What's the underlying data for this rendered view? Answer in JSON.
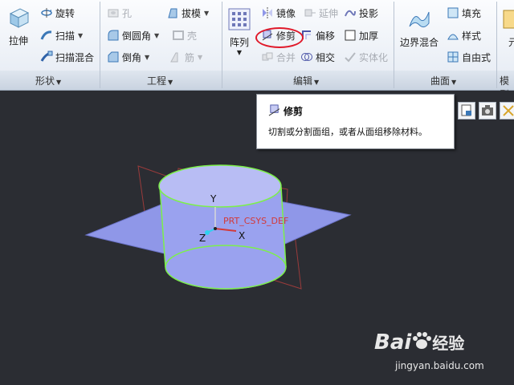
{
  "ribbon": {
    "groups": [
      {
        "label": "形状"
      },
      {
        "label": "工程"
      },
      {
        "label": "编辑"
      },
      {
        "label": "曲面"
      },
      {
        "label": "模型"
      }
    ],
    "shape": {
      "extrude": "拉伸",
      "revolve": "旋转",
      "sweep": "扫描",
      "swept_blend": "扫描混合"
    },
    "engineering": {
      "hole": "孔",
      "draft": "拔模",
      "round": "倒圆角",
      "shell": "壳",
      "chamfer": "倒角",
      "rib": "筋"
    },
    "editing": {
      "pattern": "阵列",
      "mirror": "镜像",
      "extend": "延伸",
      "project": "投影",
      "trim": "修剪",
      "offset": "偏移",
      "thicken": "加厚",
      "merge": "合并",
      "intersect": "相交",
      "solidify": "实体化"
    },
    "surfaces": {
      "boundary_blend": "边界混合",
      "fill": "填充",
      "style": "样式",
      "freestyle": "自由式"
    },
    "model_intent": {
      "label_partial": "元"
    }
  },
  "tooltip": {
    "title": "修剪",
    "description": "切割或分割面组，或者从面组移除材料。"
  },
  "viewport": {
    "csys_label": "PRT_CSYS_DEF",
    "axis_x": "X",
    "axis_y": "Y",
    "axis_z": "Z"
  },
  "watermark": {
    "brand_prefix": "Bai",
    "brand_suffix": "经验",
    "url": "jingyan.baidu.com"
  },
  "colors": {
    "viewport_bg": "#2b2d33",
    "highlight_ring": "#e0192a",
    "surface_fill": "#8f97e8",
    "edge_green": "#7cf04a"
  }
}
